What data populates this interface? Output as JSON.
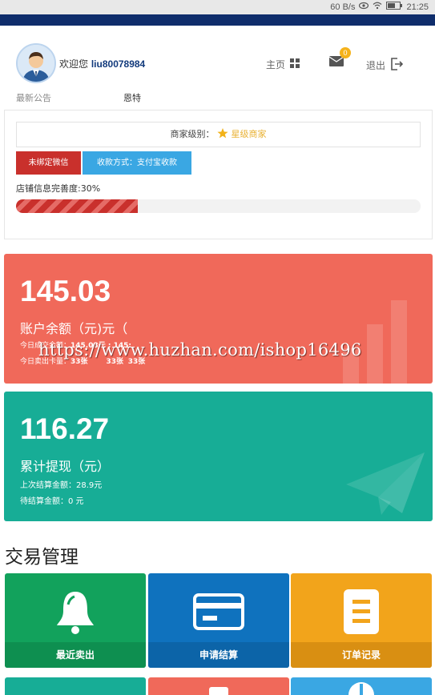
{
  "statusbar": {
    "speed": "60 B/s",
    "time": "21:25"
  },
  "header": {
    "welcome_prefix": "欢迎您",
    "username": "liu80078984",
    "home_label": "主页",
    "mail_count": "0",
    "logout_label": "退出"
  },
  "notice": {
    "label": "最新公告",
    "text": "恩特"
  },
  "merchant": {
    "level_prefix": "商家级别：",
    "level_value": "星级商家",
    "wechat_button": "未绑定微信",
    "payment_button": "收款方式：支付宝收款",
    "completeness_label": "店铺信息完善度:30%",
    "completeness_value": 0.3
  },
  "balance_card": {
    "amount": "145.03",
    "label": "账户余额（元)元（",
    "line1_prefix": "今日成交金额：",
    "line1_value": "145.03",
    "line1_suffix": "元 : 145:",
    "line2_prefix": "今日卖出卡量：",
    "line2_v1": "33张",
    "line2_v2": "33张",
    "line2_v3": "33张"
  },
  "withdraw_card": {
    "amount": "116.27",
    "label": "累计提现（元）",
    "last_settle_label": "上次结算金额：",
    "last_settle_value": "28.9元",
    "pending_label": "待结算金额：",
    "pending_value": "0 元"
  },
  "watermark": "https://www.huzhan.com/ishop16496",
  "trade": {
    "title": "交易管理",
    "tiles": [
      {
        "label": "最近卖出",
        "color": "#12a25c",
        "band": "#0e8f50",
        "icon": "bell-icon"
      },
      {
        "label": "申请结算",
        "color": "#0f72be",
        "band": "#0c64a8",
        "icon": "card-icon"
      },
      {
        "label": "订单记录",
        "color": "#f2a41b",
        "band": "#d98f12",
        "icon": "document-icon"
      }
    ],
    "row2_colors": [
      "#17ad96",
      "#f0695a",
      "#3aa7e3"
    ]
  }
}
